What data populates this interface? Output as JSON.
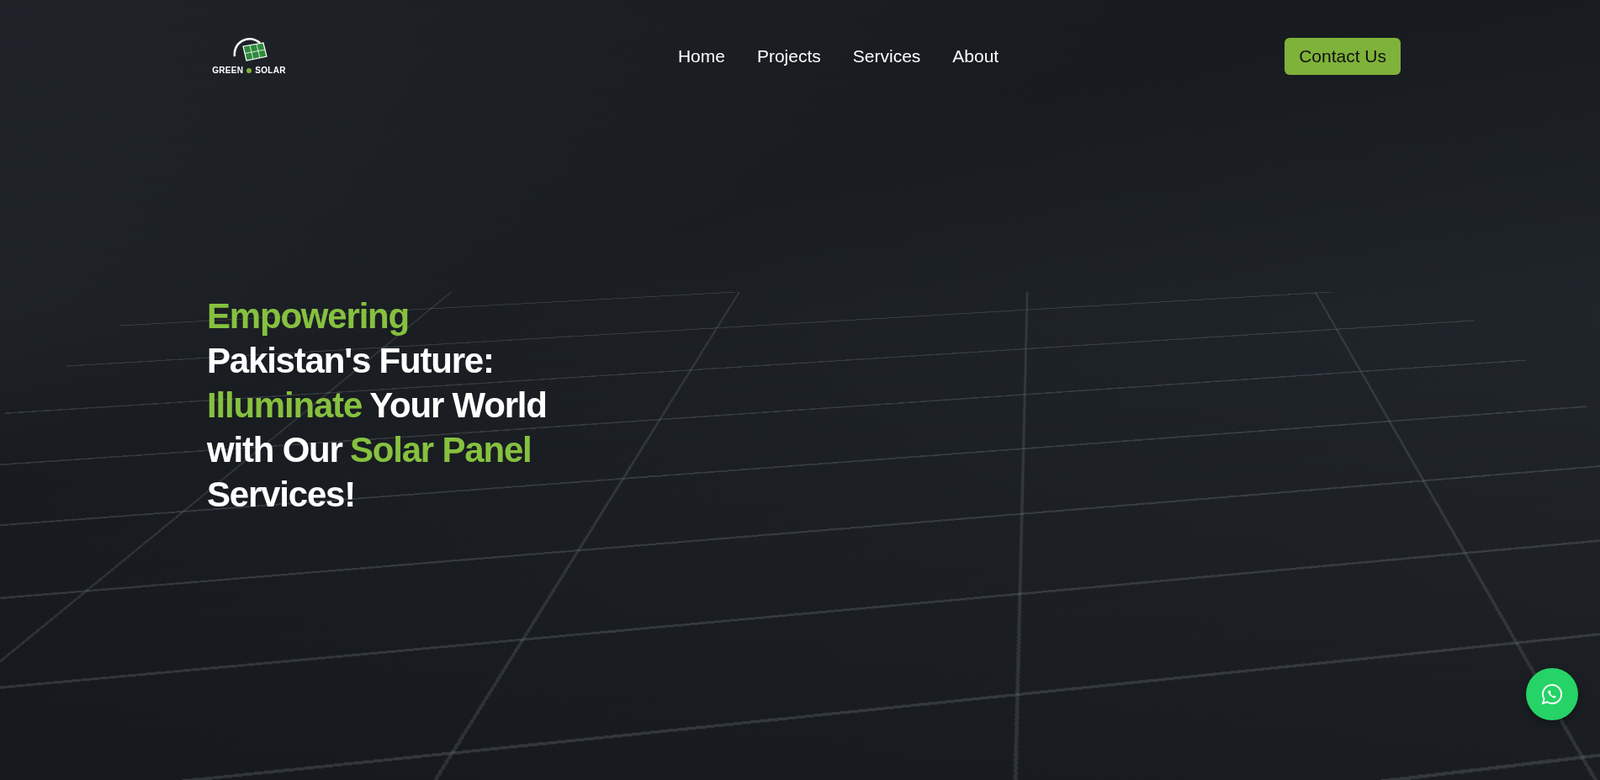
{
  "logo": {
    "left": "GREEN",
    "right": "SOLAR"
  },
  "nav": {
    "links": [
      "Home",
      "Projects",
      "Services",
      "About"
    ],
    "contact": "Contact Us"
  },
  "heading": [
    [
      {
        "text": "Empowering",
        "highlight": true
      }
    ],
    [
      {
        "text": "Pakistan's Future:",
        "highlight": false
      }
    ],
    [
      {
        "text": "Illuminate",
        "highlight": true
      },
      {
        "text": "Your World",
        "highlight": false
      }
    ],
    [
      {
        "text": "with Our",
        "highlight": false
      },
      {
        "text": "Solar Panel",
        "highlight": true
      }
    ],
    [
      {
        "text": "Services!",
        "highlight": false
      }
    ]
  ]
}
